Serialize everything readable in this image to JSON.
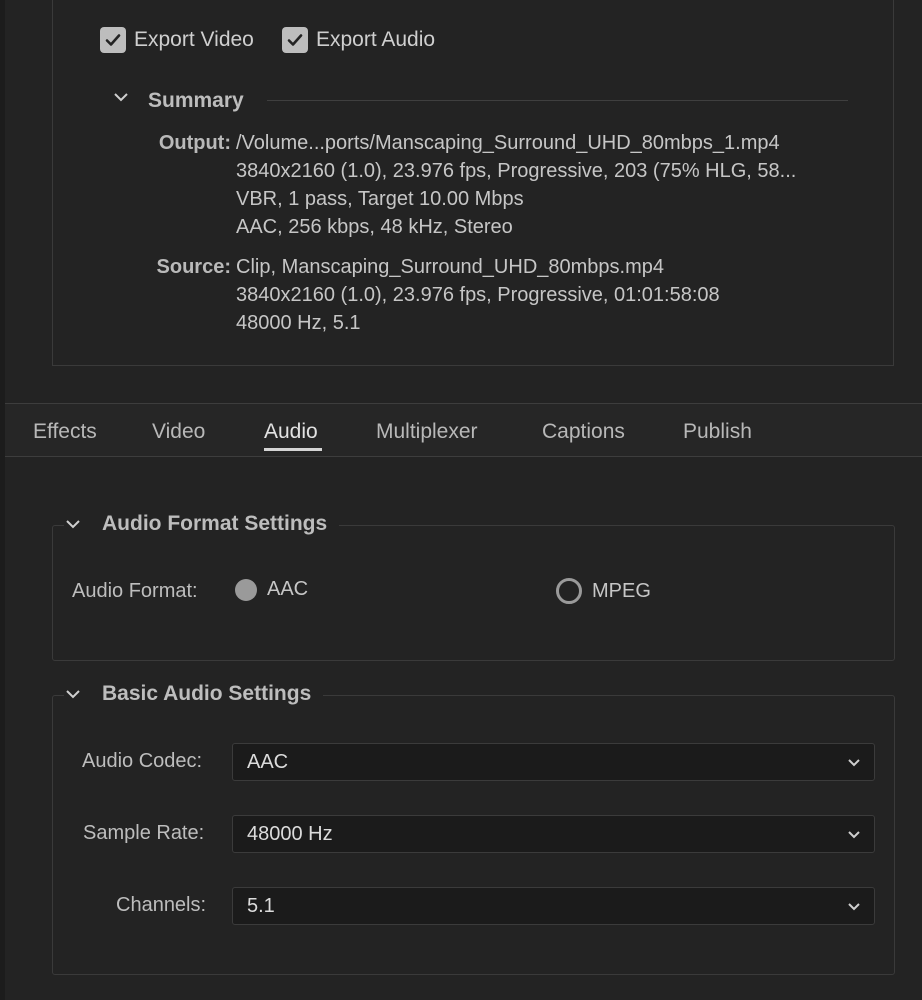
{
  "export": {
    "video_label": "Export Video",
    "audio_label": "Export Audio"
  },
  "summary": {
    "title": "Summary",
    "output_label": "Output:",
    "output_lines": [
      "/Volume...ports/Manscaping_Surround_UHD_80mbps_1.mp4",
      "3840x2160 (1.0), 23.976 fps, Progressive, 203 (75% HLG, 58...",
      "VBR, 1 pass, Target 10.00 Mbps",
      "AAC, 256 kbps, 48 kHz, Stereo"
    ],
    "source_label": "Source:",
    "source_lines": [
      "Clip, Manscaping_Surround_UHD_80mbps.mp4",
      "3840x2160 (1.0), 23.976 fps, Progressive, 01:01:58:08",
      "48000 Hz, 5.1"
    ]
  },
  "tabs": [
    "Effects",
    "Video",
    "Audio",
    "Multiplexer",
    "Captions",
    "Publish"
  ],
  "active_tab": "Audio",
  "audio_format_settings": {
    "title": "Audio Format Settings",
    "format_label": "Audio Format:",
    "options": [
      "AAC",
      "MPEG"
    ],
    "selected": "AAC"
  },
  "basic_audio_settings": {
    "title": "Basic Audio Settings",
    "codec_label": "Audio Codec:",
    "codec_value": "AAC",
    "sample_rate_label": "Sample Rate:",
    "sample_rate_value": "48000 Hz",
    "channels_label": "Channels:",
    "channels_value": "5.1"
  },
  "colors": {
    "background": "#232323",
    "checkbox_fill": "#bdbdbd",
    "text": "#c8c8c8"
  }
}
